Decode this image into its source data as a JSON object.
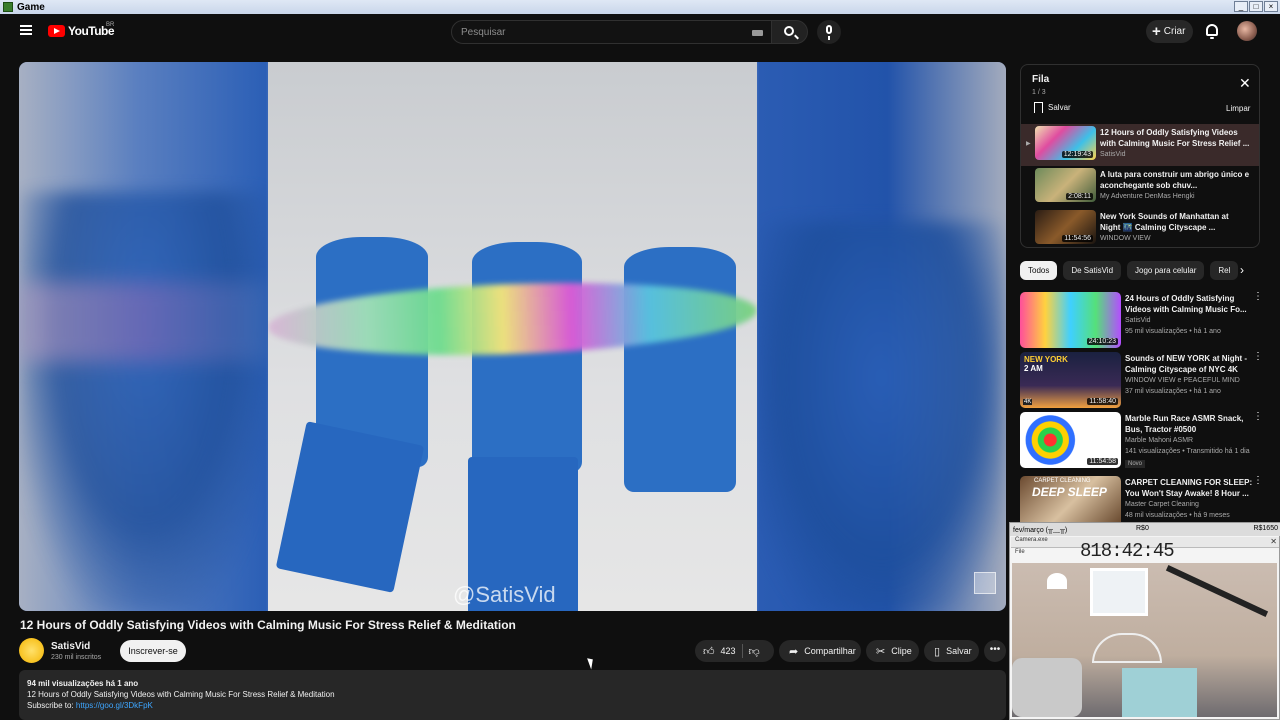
{
  "window": {
    "title": "Game"
  },
  "header": {
    "logo_text": "YouTube",
    "country_code": "BR",
    "search_placeholder": "Pesquisar",
    "create_label": "Criar"
  },
  "player": {
    "watermark": "@SatisVid"
  },
  "video": {
    "title": "12 Hours of Oddly Satisfying Videos with Calming Music For Stress Relief & Meditation",
    "channel": "SatisVid",
    "subscribers": "230 mil inscritos",
    "subscribe_label": "Inscrever-se",
    "likes": "423",
    "share_label": "Compartilhar",
    "clip_label": "Clipe",
    "save_label": "Salvar",
    "description": {
      "meta": "94 mil visualizações  há 1 ano",
      "line1": "12 Hours of Oddly Satisfying Videos with Calming Music For Stress Relief & Meditation",
      "subscribe_prefix": "Subscribe to: ",
      "link": "https://goo.gl/3DkFpK"
    }
  },
  "queue": {
    "title": "Fila",
    "count": "1 / 3",
    "save_label": "Salvar",
    "clear_label": "Limpar",
    "items": [
      {
        "title": "12 Hours of Oddly Satisfying Videos with Calming Music For Stress Relief ...",
        "channel": "SatisVid",
        "duration": "12:19:43"
      },
      {
        "title": "A luta para construir um abrigo único e aconchegante sob chuv...",
        "channel": "My Adventure DenMas Hengki",
        "duration": "2:08:11"
      },
      {
        "title": "New York Sounds of Manhattan at Night 🌃 Calming Cityscape ...",
        "channel": "WINDOW VIEW",
        "duration": "11:54:56"
      }
    ]
  },
  "chips": [
    "Todos",
    "De SatisVid",
    "Jogo para celular",
    "Rel"
  ],
  "recommendations": [
    {
      "title": "24 Hours of Oddly Satisfying Videos with Calming Music Fo...",
      "channel": "SatisVid",
      "meta": "95 mil visualizações • há 1 ano",
      "duration": "24:10:23",
      "badge": ""
    },
    {
      "title": "Sounds of NEW YORK at Night - Calming Cityscape of NYC 4K",
      "channel": "WINDOW VIEW e PEACEFUL MIND",
      "meta": "37 mil visualizações • há 1 ano",
      "duration": "11:58:40",
      "badge": ""
    },
    {
      "title": "Marble Run Race ASMR Snack, Bus, Tractor #0500",
      "channel": "Marble Mahoni ASMR",
      "meta": "141 visualizações • Transmitido há 1 dia",
      "duration": "11:54:58",
      "badge": "Novo"
    },
    {
      "title": "CARPET CLEANING FOR SLEEP: You Won't Stay Awake! 8 Hour ...",
      "channel": "Master Carpet Cleaning",
      "meta": "48 mil visualizações • há 9 meses",
      "duration": "",
      "badge": ""
    }
  ],
  "thumb_texts": {
    "ny_line1": "NEW YORK",
    "ny_line2": "2 AM",
    "ny_4k": "4K",
    "carpet_top": "CARPET CLEANING",
    "carpet_main": "DEEP SLEEP"
  },
  "overlay": {
    "status_left": "fev/março (╥﹏╥)",
    "status_mid": "R$0",
    "status_right": "R$1650",
    "window_title": "Camera.exe",
    "menu": "File",
    "timer": "818:42:45"
  }
}
